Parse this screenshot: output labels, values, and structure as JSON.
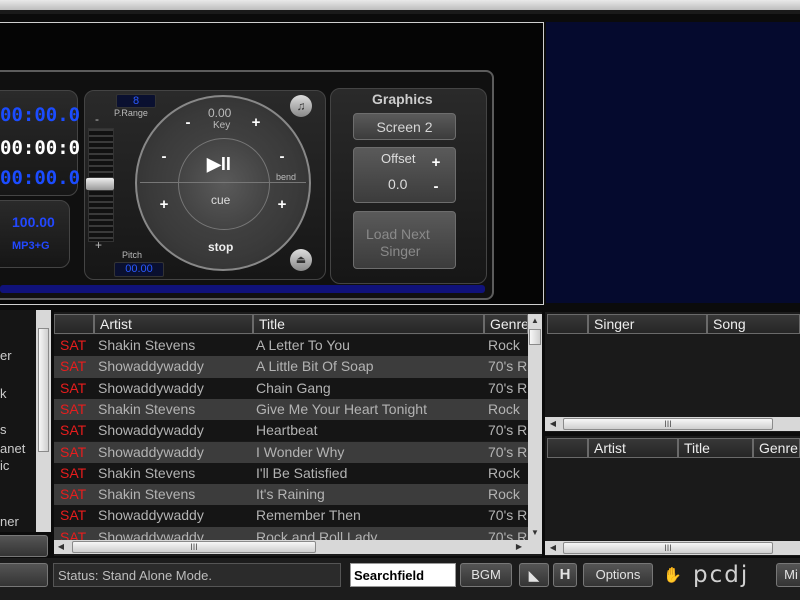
{
  "deck": {
    "time_elapsed": "00:00.0",
    "time_total": "00:00:0",
    "time_remain": "00:00.0",
    "bpm": "100.00",
    "format": "MP3+G",
    "prange_value": "8",
    "prange_label": "P.Range",
    "key_value": "0.00",
    "key_label": "Key",
    "pitch_label": "Pitch",
    "pitch_value": "00.00",
    "bend_label": "bend",
    "cue_label": "cue",
    "stop_label": "stop",
    "play_symbol": "▶II",
    "minus": "-",
    "plus": "+"
  },
  "graphics": {
    "title": "Graphics",
    "screen_button": "Screen 2",
    "offset_label": "Offset",
    "offset_value": "0.0",
    "load_next_line1": "Load Next",
    "load_next_line2": "Singer"
  },
  "sidebar": {
    "items": [
      "er",
      "k",
      "s",
      "anet",
      "ic",
      "ner"
    ]
  },
  "songlist": {
    "columns": [
      "Artist",
      "Title",
      "Genre"
    ],
    "rows": [
      {
        "tag": "SAT",
        "artist": "Shakin Stevens",
        "title": "A Letter To You",
        "genre": "Rock"
      },
      {
        "tag": "SAT",
        "artist": "Showaddywaddy",
        "title": "A Little Bit Of Soap",
        "genre": "70's R"
      },
      {
        "tag": "SAT",
        "artist": "Showaddywaddy",
        "title": "Chain Gang",
        "genre": "70's R"
      },
      {
        "tag": "SAT",
        "artist": "Shakin Stevens",
        "title": "Give Me Your Heart Tonight",
        "genre": "Rock"
      },
      {
        "tag": "SAT",
        "artist": "Showaddywaddy",
        "title": "Heartbeat",
        "genre": "70's R"
      },
      {
        "tag": "SAT",
        "artist": "Showaddywaddy",
        "title": "I Wonder Why",
        "genre": "70's R"
      },
      {
        "tag": "SAT",
        "artist": "Shakin Stevens",
        "title": "I'll Be Satisfied",
        "genre": "Rock"
      },
      {
        "tag": "SAT",
        "artist": "Shakin Stevens",
        "title": "It's Raining",
        "genre": "Rock"
      },
      {
        "tag": "SAT",
        "artist": "Showaddywaddy",
        "title": "Remember Then",
        "genre": "70's R"
      },
      {
        "tag": "SAT",
        "artist": "Showaddywaddy",
        "title": "Rock and Roll Lady",
        "genre": "70's R"
      }
    ]
  },
  "rotation": {
    "columns": [
      "Singer",
      "Song"
    ]
  },
  "queue": {
    "columns": [
      "Artist",
      "Title",
      "Genre"
    ]
  },
  "scroll_grip": "III",
  "statusbar": {
    "status": "Status: Stand Alone Mode.",
    "search_value": "Searchfield",
    "bgm": "BGM",
    "h": "H",
    "options": "Options",
    "logo": "pcdj",
    "mix": "Mi"
  },
  "colors": {
    "accent_blue": "#1b4cff",
    "sat_red": "#e81d1d",
    "video_bg": "#050a2e"
  }
}
